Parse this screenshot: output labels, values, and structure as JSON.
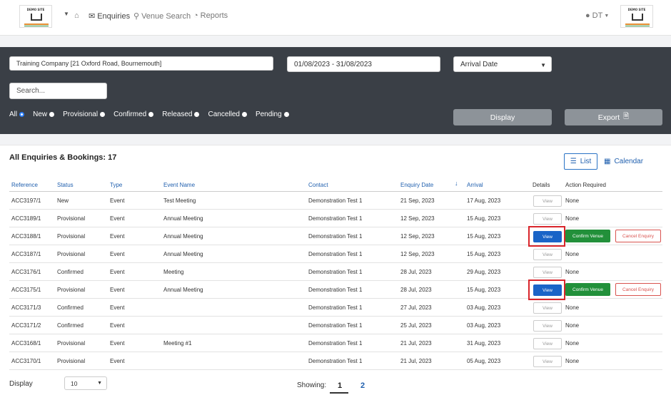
{
  "header": {
    "logo_text": "DEMO SITE",
    "logo_tagline": "YOUR LOGO HERE",
    "nav": [
      {
        "label": "Enquiries",
        "icon": "envelope-icon"
      },
      {
        "label": "Venue Search",
        "icon": "search-icon"
      },
      {
        "label": "Reports",
        "icon": "pie-chart-icon"
      }
    ],
    "user": "DT"
  },
  "filters": {
    "company_value": "Training Company [21 Oxford Road, Bournemouth]",
    "date_range": "01/08/2023 - 31/08/2023",
    "date_field": "Arrival Date",
    "search_placeholder": "Search...",
    "statuses": [
      "All",
      "New",
      "Provisional",
      "Confirmed",
      "Released",
      "Cancelled",
      "Pending"
    ],
    "selected_status": "All",
    "display_label": "Display",
    "export_label": "Export"
  },
  "summary": {
    "title": "All Enquiries & Bookings:",
    "count": "17",
    "list_label": "List",
    "calendar_label": "Calendar"
  },
  "table": {
    "columns": {
      "reference": "Reference",
      "status": "Status",
      "type": "Type",
      "event_name": "Event Name",
      "contact": "Contact",
      "enquiry_date": "Enquiry Date",
      "arrival": "Arrival",
      "details": "Details",
      "action": "Action Required"
    },
    "view_label": "View",
    "confirm_label": "Confirm Venue",
    "cancel_label": "Cancel Enquiry",
    "rows": [
      {
        "ref": "ACC3197/1",
        "status": "New",
        "type": "Event",
        "name": "Test Meeting",
        "contact": "Demonstration Test 1",
        "enquiry": "21 Sep, 2023",
        "arrival": "17 Aug, 2023",
        "action": "None"
      },
      {
        "ref": "ACC3189/1",
        "status": "Provisional",
        "type": "Event",
        "name": "Annual Meeting",
        "contact": "Demonstration Test 1",
        "enquiry": "12 Sep, 2023",
        "arrival": "15 Aug, 2023",
        "action": "None"
      },
      {
        "ref": "ACC3188/1",
        "status": "Provisional",
        "type": "Event",
        "name": "Annual Meeting",
        "contact": "Demonstration Test 1",
        "enquiry": "12 Sep, 2023",
        "arrival": "15 Aug, 2023",
        "action": ""
      },
      {
        "ref": "ACC3187/1",
        "status": "Provisional",
        "type": "Event",
        "name": "Annual Meeting",
        "contact": "Demonstration Test 1",
        "enquiry": "12 Sep, 2023",
        "arrival": "15 Aug, 2023",
        "action": "None"
      },
      {
        "ref": "ACC3176/1",
        "status": "Confirmed",
        "type": "Event",
        "name": "Meeting",
        "contact": "Demonstration Test 1",
        "enquiry": "28 Jul, 2023",
        "arrival": "29 Aug, 2023",
        "action": "None"
      },
      {
        "ref": "ACC3175/1",
        "status": "Provisional",
        "type": "Event",
        "name": "Annual Meeting",
        "contact": "Demonstration Test 1",
        "enquiry": "28 Jul, 2023",
        "arrival": "15 Aug, 2023",
        "action": ""
      },
      {
        "ref": "ACC3171/3",
        "status": "Confirmed",
        "type": "Event",
        "name": "",
        "contact": "Demonstration Test 1",
        "enquiry": "27 Jul, 2023",
        "arrival": "03 Aug, 2023",
        "action": "None"
      },
      {
        "ref": "ACC3171/2",
        "status": "Confirmed",
        "type": "Event",
        "name": "",
        "contact": "Demonstration Test 1",
        "enquiry": "25 Jul, 2023",
        "arrival": "03 Aug, 2023",
        "action": "None"
      },
      {
        "ref": "ACC3168/1",
        "status": "Provisional",
        "type": "Event",
        "name": "Meeting #1",
        "contact": "Demonstration Test 1",
        "enquiry": "21 Jul, 2023",
        "arrival": "31 Aug, 2023",
        "action": "None"
      },
      {
        "ref": "ACC3170/1",
        "status": "Provisional",
        "type": "Event",
        "name": "",
        "contact": "Demonstration Test 1",
        "enquiry": "21 Jul, 2023",
        "arrival": "05 Aug, 2023",
        "action": "None"
      }
    ]
  },
  "footer": {
    "display_label": "Display",
    "page_size": "10",
    "showing_label": "Showing:",
    "pages": [
      "1",
      "2"
    ],
    "current_page": "1"
  }
}
